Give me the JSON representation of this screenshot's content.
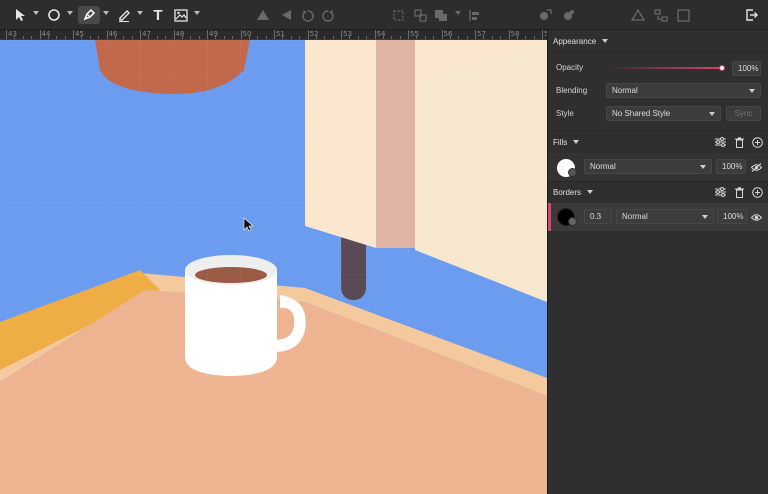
{
  "toolbar": {
    "text_tool_glyph": "T",
    "icons": [
      "pointer-icon",
      "oval-icon",
      "pen-icon",
      "pencil-icon",
      "text-icon",
      "image-icon",
      "mask-icon",
      "rotate-icon",
      "undo-icon",
      "redo-icon",
      "group-icon",
      "boolean-icon",
      "align-icon",
      "export-icon",
      "symbol-icon",
      "layers-icon",
      "view-icon",
      "exit-icon"
    ]
  },
  "ruler": {
    "labels": [
      "43",
      "44",
      "45",
      "46",
      "47",
      "48",
      "49",
      "50",
      "51",
      "52",
      "53",
      "54",
      "55",
      "56",
      "57",
      "58",
      "59"
    ]
  },
  "appearance": {
    "title": "Appearance",
    "opacity_label": "Opacity",
    "opacity_value": "100%",
    "opacity_level": 1.0,
    "blending_label": "Blending",
    "blending_value": "Normal",
    "style_label": "Style",
    "style_value": "No Shared Style",
    "sync_label": "Sync"
  },
  "fills": {
    "title": "Fills",
    "items": [
      {
        "blend": "Normal",
        "opacity": "100%",
        "swatch_color": "#ffffff"
      }
    ]
  },
  "borders": {
    "title": "Borders",
    "items": [
      {
        "width": "0.3",
        "blend": "Normal",
        "opacity": "100%",
        "swatch_color": "#000000"
      }
    ]
  },
  "colors": {
    "accent": "#d6456a",
    "sky": "#6b9cf0",
    "floor": "#eeb492",
    "mug": "#ffffff",
    "coffee": "#9a5a44"
  }
}
